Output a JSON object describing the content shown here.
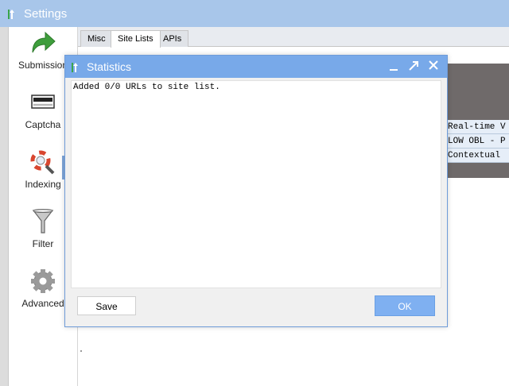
{
  "window": {
    "title": "Settings",
    "icon": "app-logo-icon"
  },
  "sidebar": {
    "items": [
      {
        "label": "Submission",
        "icon": "green-arrow-icon"
      },
      {
        "label": "Captcha",
        "icon": "captcha-icon"
      },
      {
        "label": "Indexing",
        "icon": "lifebuoy-magnifier-icon"
      },
      {
        "label": "Filter",
        "icon": "funnel-icon"
      },
      {
        "label": "Advanced",
        "icon": "gear-icon"
      }
    ]
  },
  "tabs": [
    {
      "label": "Misc",
      "active": false
    },
    {
      "label": "Site Lists",
      "active": true
    },
    {
      "label": "APIs",
      "active": false
    }
  ],
  "background_rows": [
    "Real-time V",
    "LOW OBL - P",
    "Contextual"
  ],
  "dialog": {
    "title": "Statistics",
    "message": "Added 0/0 URLs to site list.",
    "save_label": "Save",
    "ok_label": "OK"
  },
  "colors": {
    "titlebar": "#a8c6ea",
    "dialog_titlebar": "#78a9e9",
    "ok_button": "#7fb0f1",
    "table_header": "#6f6a6a"
  }
}
